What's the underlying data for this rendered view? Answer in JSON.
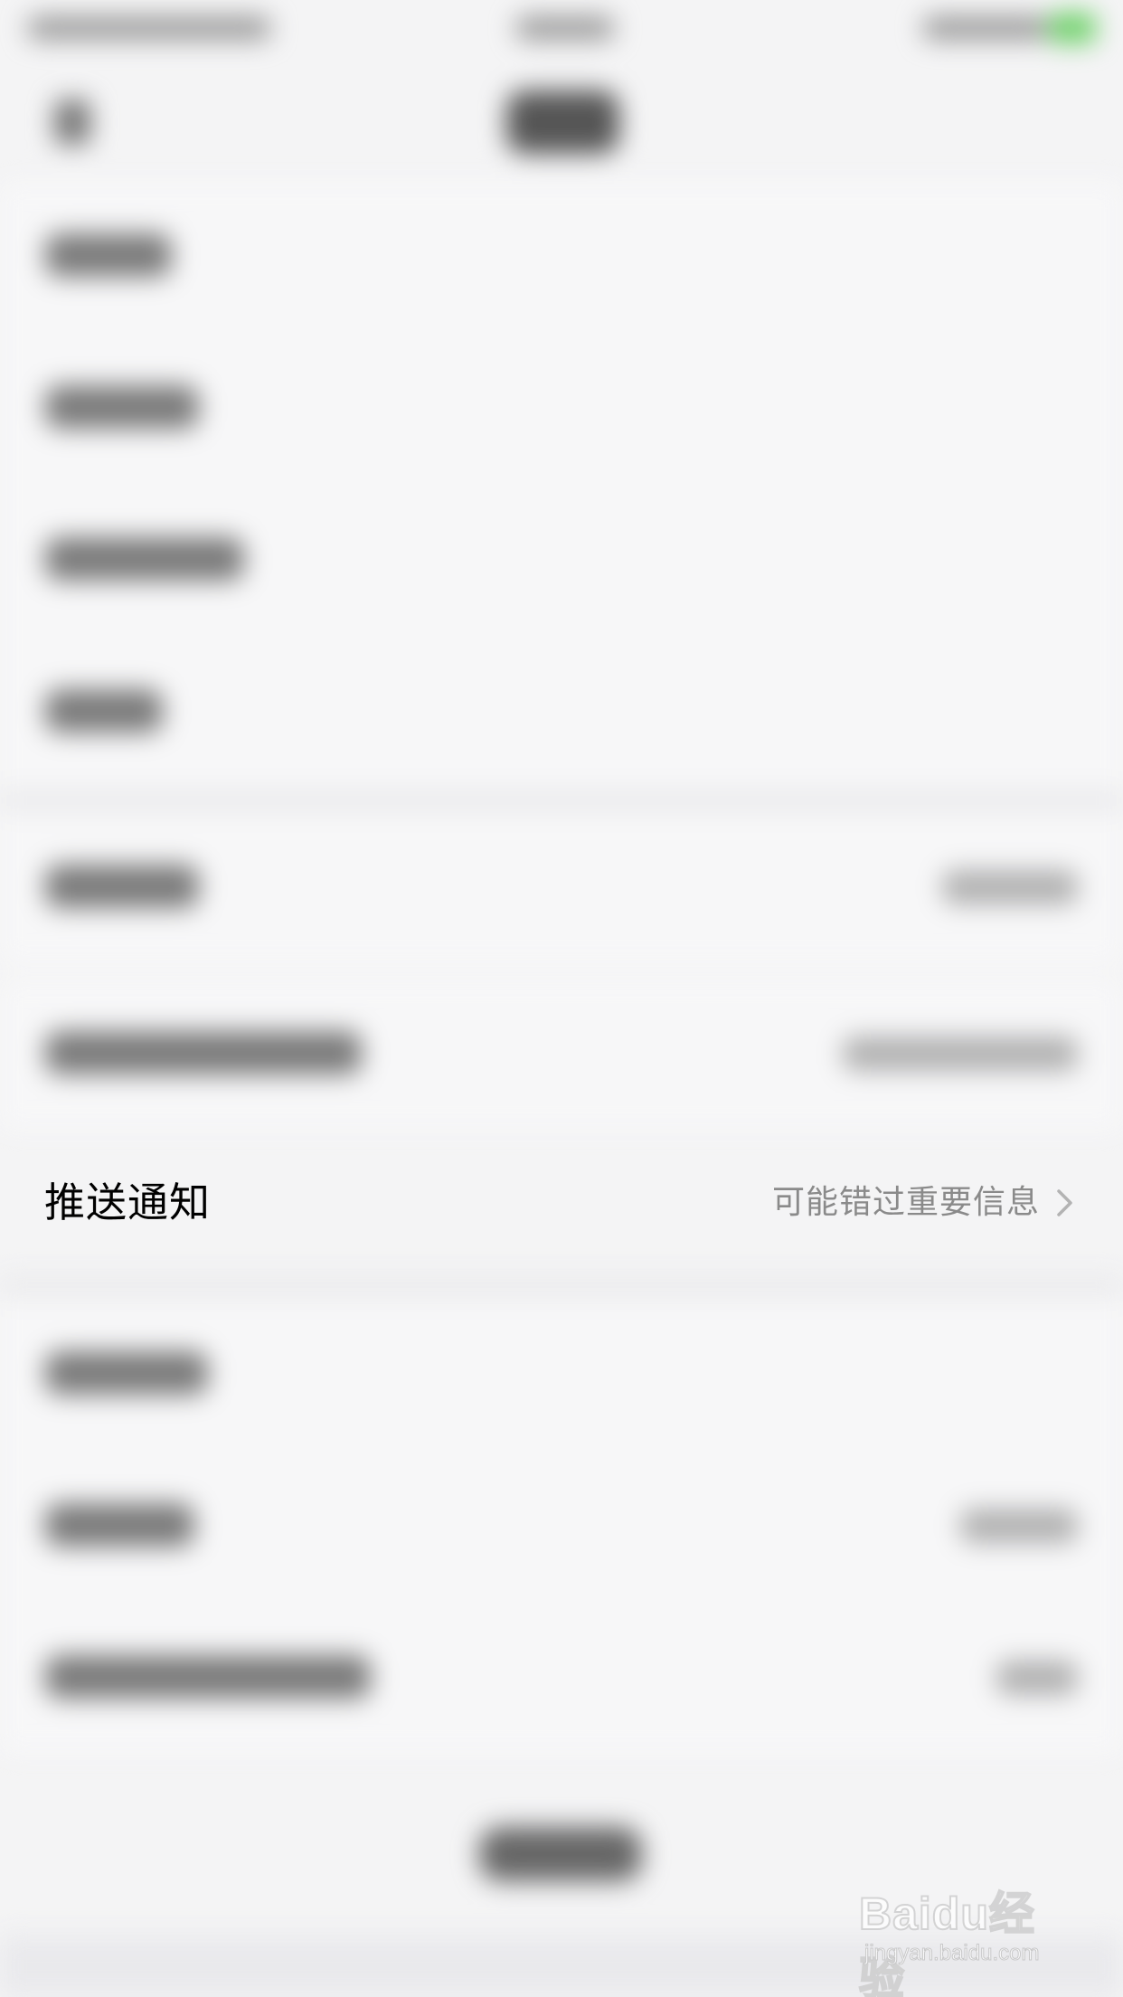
{
  "settings_row": {
    "label": "推送通知",
    "value": "可能错过重要信息"
  },
  "watermark": {
    "brand": "Baidu经验",
    "url": "jingyan.baidu.com"
  },
  "colors": {
    "page_background": "#f4f4f5",
    "label_text": "#000000",
    "value_text": "#8a8a8a",
    "battery": "#6fd16a"
  },
  "icons": {
    "row_chevron": "chevron-right-icon"
  }
}
